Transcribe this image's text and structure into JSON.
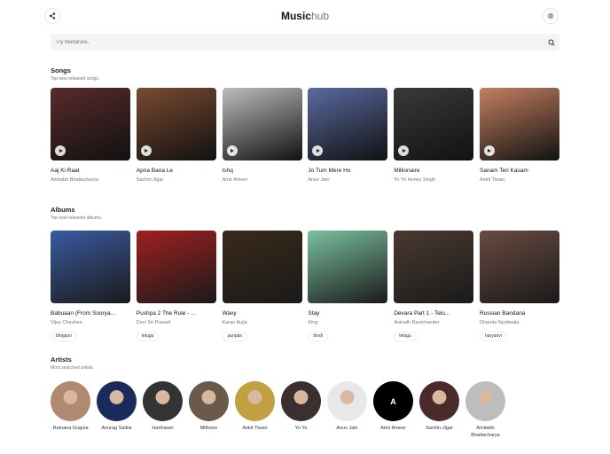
{
  "header": {
    "logo_bold": "Music",
    "logo_light": "hub",
    "share_icon": "share-icon",
    "theme_icon": "sun-icon"
  },
  "search": {
    "placeholder": "Try Maharani.."
  },
  "songs": {
    "title": "Songs",
    "subtitle": "Top new released songs.",
    "items": [
      {
        "title": "Aaj Ki Raat",
        "artist": "Amitabh Bhattacharya",
        "color": "#5a2a2a"
      },
      {
        "title": "Apna Bana Le",
        "artist": "Sachin-Jigar",
        "color": "#7a4a30"
      },
      {
        "title": "Ishq",
        "artist": "Amir Ameer",
        "color": "#bdbdbd"
      },
      {
        "title": "Jo Tum Mere Ho",
        "artist": "Anuv Jain",
        "color": "#5a6aa0"
      },
      {
        "title": "Millionaire",
        "artist": "Yo Yo Honey Singh",
        "color": "#3a3a3a"
      },
      {
        "title": "Sanam Teri Kasam",
        "artist": "Ankit Tiwari",
        "color": "#c48060"
      }
    ]
  },
  "albums": {
    "title": "Albums",
    "subtitle": "Top new released albums.",
    "items": [
      {
        "title": "Babuaan (From Soorya...",
        "artist": "Vijay Chauhan",
        "tag": "bhojpuri",
        "color": "#3a5aa0"
      },
      {
        "title": "Pushpa 2 The Rule - ...",
        "artist": "Devi Sri Prasad",
        "tag": "telugu",
        "color": "#a02020"
      },
      {
        "title": "Wavy",
        "artist": "Karan Aujla",
        "tag": "punjabi",
        "color": "#3a2a1a"
      },
      {
        "title": "Stay",
        "artist": "King",
        "tag": "hindi",
        "color": "#7ac0a0"
      },
      {
        "title": "Devara Part 1 - Telu...",
        "artist": "Anirudh Ravichander",
        "tag": "telugu",
        "color": "#4a3a30"
      },
      {
        "title": "Russian Bandana",
        "artist": "Dhanda Nyoliwala",
        "tag": "haryanvi",
        "color": "#6a4a40"
      }
    ]
  },
  "artists": {
    "title": "Artists",
    "subtitle": "Most searched artists.",
    "items": [
      {
        "name": "Ramana Gogula",
        "color": "#b08a70",
        "initial": ""
      },
      {
        "name": "Anurag Saikia",
        "color": "#1a2a5a",
        "initial": ""
      },
      {
        "name": "Hariharan",
        "color": "#333333",
        "initial": ""
      },
      {
        "name": "Mithoon",
        "color": "#6a5a4a",
        "initial": ""
      },
      {
        "name": "Ankit Tiwari",
        "color": "#c0a040",
        "initial": ""
      },
      {
        "name": "Yo Yo",
        "color": "#3a3030",
        "initial": ""
      },
      {
        "name": "Anuv Jain",
        "color": "#e8e8e8",
        "initial": ""
      },
      {
        "name": "Amir Ameer",
        "color": "#000000",
        "initial": "A"
      },
      {
        "name": "Sachin-Jigar",
        "color": "#4a2a2a",
        "initial": ""
      },
      {
        "name": "Amitabh Bhattacharya",
        "color": "#bdbdbd",
        "initial": ""
      }
    ]
  }
}
